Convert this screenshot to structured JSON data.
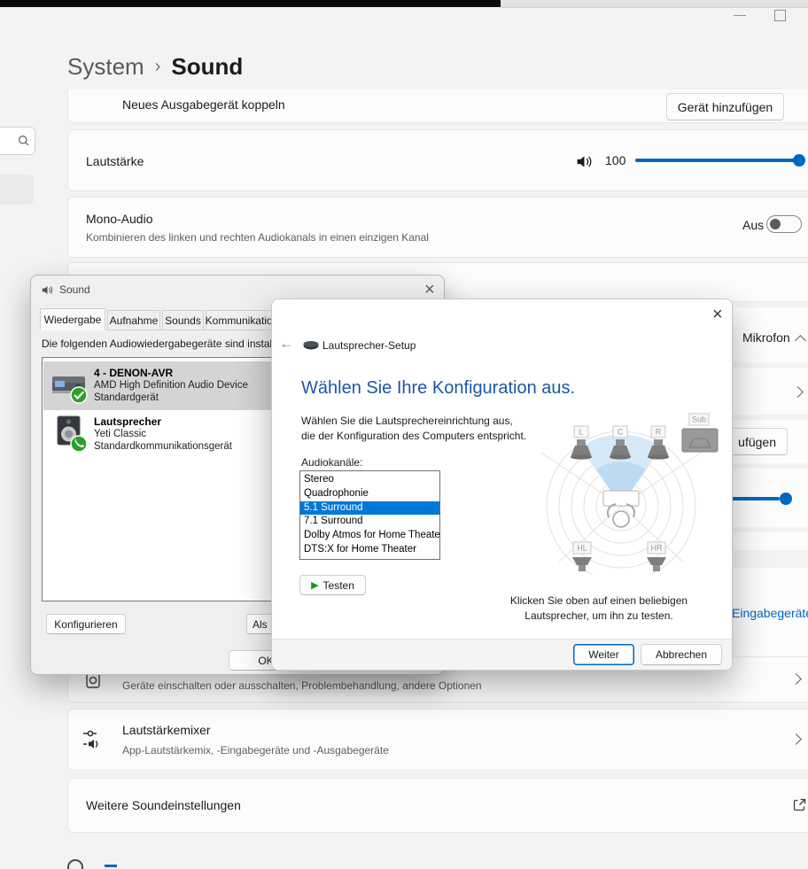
{
  "breadcrumb": {
    "parent": "System",
    "separator": "›",
    "current": "Sound"
  },
  "output_section": {
    "pair_label": "Neues Ausgabegerät koppeln",
    "pair_button": "Gerät hinzufügen",
    "volume_label": "Lautstärke",
    "volume_value": "100",
    "mono_title": "Mono-Audio",
    "mono_subtitle": "Kombinieren des linken und rechten Audiokanals in einen einzigen Kanal",
    "mono_state": "Aus"
  },
  "input_section": {
    "mikrofon_label": "Mikrofon",
    "add_button_fragment": "ufügen",
    "devices_link_fragment": "Eingabegeräte"
  },
  "advanced_section": {
    "all_devices_subtitle": "Geräte einschalten oder ausschalten, Problembehandlung, andere Optionen",
    "mixer_title": "Lautstärkemixer",
    "mixer_subtitle": "App-Lautstärkemix, -Eingabegeräte und -Ausgabegeräte",
    "more_title": "Weitere Soundeinstellungen"
  },
  "sound_dialog": {
    "title": "Sound",
    "tabs": [
      "Wiedergabe",
      "Aufnahme",
      "Sounds",
      "Kommunikation"
    ],
    "intro": "Die folgenden Audiowiedergabegeräte sind installiert:",
    "devices": [
      {
        "name": "4 - DENON-AVR",
        "detail": "AMD High Definition Audio Device",
        "status": "Standardgerät"
      },
      {
        "name": "Lautsprecher",
        "detail": "Yeti Classic",
        "status": "Standardkommunikationsgerät"
      }
    ],
    "configure_button": "Konfigurieren",
    "default_button_fragment": "Als Standard",
    "ok_button": "OK"
  },
  "wizard": {
    "title": "Lautsprecher-Setup",
    "heading": "Wählen Sie Ihre Konfiguration aus.",
    "description": "Wählen Sie die Lautsprechereinrichtung aus, die der Konfiguration des Computers entspricht.",
    "channels_label": "Audiokanäle:",
    "channels": [
      "Stereo",
      "Quadrophonie",
      "5.1 Surround",
      "7.1 Surround",
      "Dolby Atmos for Home Theater",
      "DTS:X for Home Theater"
    ],
    "selected_channel": "5.1 Surround",
    "test_button": "Testen",
    "diagram": {
      "front_left": "L",
      "center": "C",
      "front_right": "R",
      "sub": "Sub",
      "rear_left": "HL",
      "rear_right": "HR"
    },
    "hint": "Klicken Sie oben auf einen beliebigen Lautsprecher, um ihn zu testen.",
    "next_button": "Weiter",
    "cancel_button": "Abbrechen"
  },
  "colors": {
    "accent": "#0067c0",
    "selection": "#0078d7",
    "wizard_heading": "#1c58a6"
  }
}
